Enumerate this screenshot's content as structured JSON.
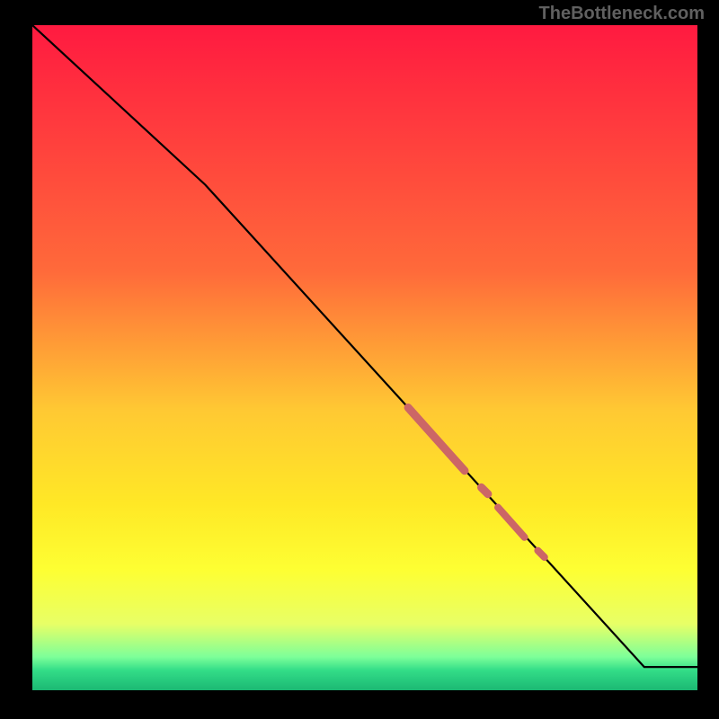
{
  "watermark": "TheBottleneck.com",
  "colors": {
    "line": "#000000",
    "marker": "#cc6666",
    "gradient_stops": [
      {
        "offset": 0,
        "color": "#ff1a40"
      },
      {
        "offset": 37,
        "color": "#ff6a3a"
      },
      {
        "offset": 58,
        "color": "#ffc933"
      },
      {
        "offset": 72,
        "color": "#ffe826"
      },
      {
        "offset": 82,
        "color": "#fdff33"
      },
      {
        "offset": 90,
        "color": "#e8ff66"
      },
      {
        "offset": 95,
        "color": "#7dff99"
      },
      {
        "offset": 97,
        "color": "#33dd88"
      },
      {
        "offset": 100,
        "color": "#1bb873"
      }
    ]
  },
  "chart_data": {
    "type": "line",
    "title": "",
    "xlabel": "",
    "ylabel": "",
    "xlim": [
      0,
      100
    ],
    "ylim": [
      0,
      100
    ],
    "series": [
      {
        "name": "curve",
        "x": [
          0,
          26,
          92,
          100
        ],
        "y": [
          100,
          76,
          3.5,
          3.5
        ]
      }
    ],
    "markers": [
      {
        "segment_start": [
          56.5,
          42.5
        ],
        "segment_end": [
          65.0,
          33.0
        ],
        "width": 9
      },
      {
        "segment_start": [
          67.5,
          30.5
        ],
        "segment_end": [
          68.5,
          29.5
        ],
        "width": 9
      },
      {
        "segment_start": [
          70.0,
          27.5
        ],
        "segment_end": [
          74.0,
          23.0
        ],
        "width": 8
      },
      {
        "segment_start": [
          76.0,
          21.0
        ],
        "segment_end": [
          77.0,
          20.0
        ],
        "width": 8
      }
    ]
  }
}
